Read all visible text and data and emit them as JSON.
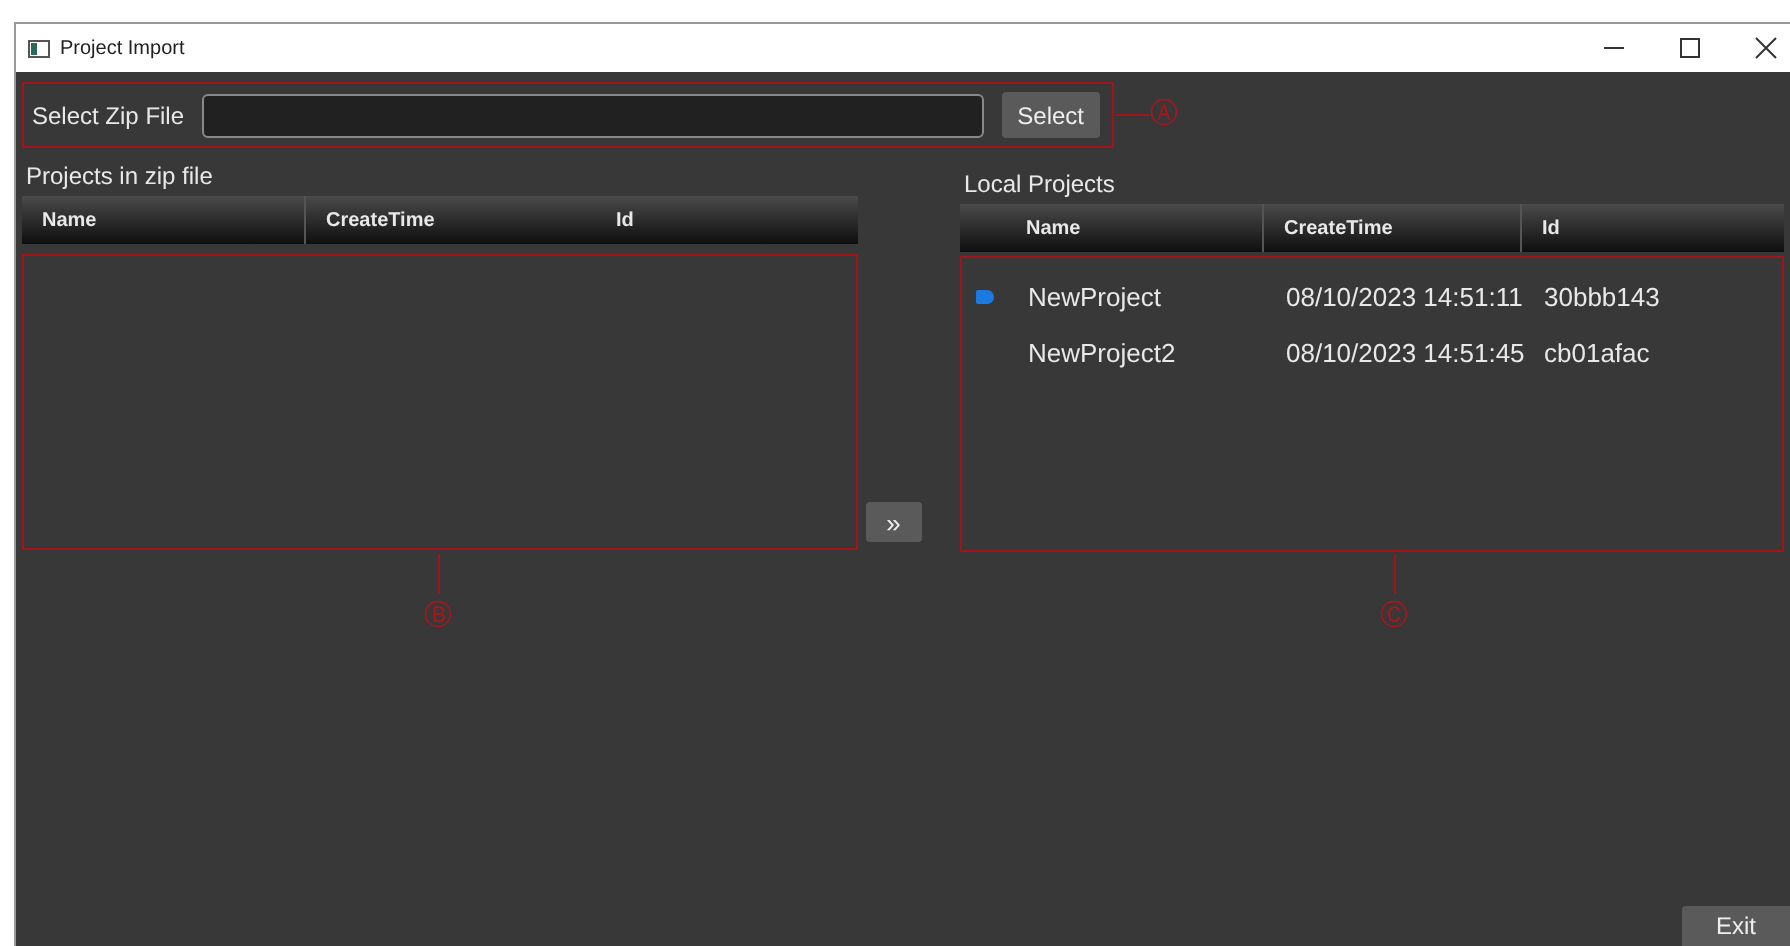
{
  "window": {
    "title": "Project Import"
  },
  "zip_file": {
    "label": "Select Zip File",
    "button": "Select",
    "callout": "Ⓐ"
  },
  "zip_projects": {
    "title": "Projects in zip file",
    "columns": [
      "Name",
      "CreateTime",
      "Id"
    ],
    "callout": "Ⓑ"
  },
  "move_button": "»",
  "local_projects": {
    "title": "Local Projects",
    "columns": [
      "Name",
      "CreateTime",
      "Id"
    ],
    "callout": "Ⓒ",
    "rows": [
      {
        "name": "NewProject",
        "create_time": "08/10/2023 14:51:11",
        "id": "30bbb143",
        "selected": true
      },
      {
        "name": "NewProject2",
        "create_time": "08/10/2023 14:51:45",
        "id": "cb01afac",
        "selected": false
      }
    ]
  },
  "exit_button": "Exit"
}
